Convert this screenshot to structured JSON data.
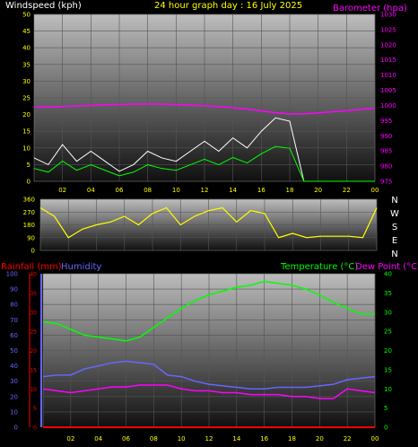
{
  "header": {
    "wind_title": "Windspeed (kph)",
    "date_title": "24 hour graph day : 16 July 2025",
    "baro_title": "Barometer (hpa)",
    "rain_title": "Rainfall (mm)",
    "hum_title": "Humidity",
    "temp_title": "Temperature (°C)",
    "dew_title": "Dew Point (°C)"
  },
  "colors": {
    "windspeed": "#ffffff",
    "windspeed_avg": "#00ff00",
    "barometer": "#ff00ff",
    "direction": "#ffff00",
    "rainfall": "#ff0000",
    "humidity": "#6666ff",
    "temperature": "#00ff00",
    "dew_point": "#ff00ff",
    "axis_left": "#ffff00",
    "axis_baro": "#ff00ff",
    "axis_hum": "#6666ff",
    "axis_rain": "#ff0000",
    "axis_temp": "#00ff00"
  },
  "x_ticks": [
    "02",
    "04",
    "06",
    "08",
    "10",
    "12",
    "14",
    "16",
    "18",
    "20",
    "22",
    "00"
  ],
  "chart_data": [
    {
      "type": "line",
      "name": "wind-baro",
      "x_hours": [
        0,
        1,
        2,
        3,
        4,
        5,
        6,
        7,
        8,
        9,
        10,
        11,
        12,
        13,
        14,
        15,
        16,
        17,
        18,
        19,
        20,
        21,
        22,
        23,
        24
      ],
      "series": [
        {
          "name": "Windspeed (kph)",
          "axis": "left",
          "values": [
            7,
            5,
            11,
            6,
            9,
            6,
            3,
            5,
            9,
            7,
            6,
            9,
            12,
            9,
            13,
            10,
            15,
            19,
            18,
            0,
            0,
            0,
            0,
            0,
            0
          ]
        },
        {
          "name": "Barometer (hpa)",
          "axis": "right",
          "values": [
            999.5,
            999.5,
            999.6,
            999.8,
            1000,
            1000.2,
            1000.3,
            1000.4,
            1000.5,
            1000.4,
            1000.3,
            1000.1,
            999.9,
            999.6,
            999.2,
            998.8,
            998.2,
            997.6,
            997.2,
            997.2,
            997.5,
            997.9,
            998.3,
            998.7,
            999.1
          ]
        }
      ],
      "ylim_left": [
        0,
        50
      ],
      "ylim_right": [
        975,
        1030
      ],
      "yticks_left": [
        0,
        5,
        10,
        15,
        20,
        25,
        30,
        35,
        40,
        45,
        50
      ],
      "yticks_right": [
        975,
        980,
        985,
        990,
        995,
        1000,
        1005,
        1010,
        1015,
        1020,
        1025,
        1030
      ]
    },
    {
      "type": "line",
      "name": "wind-direction",
      "x_hours": [
        0,
        1,
        2,
        3,
        4,
        5,
        6,
        7,
        8,
        9,
        10,
        11,
        12,
        13,
        14,
        15,
        16,
        17,
        18,
        19,
        20,
        21,
        22,
        23,
        24
      ],
      "series": [
        {
          "name": "Wind direction",
          "values": [
            300,
            240,
            90,
            150,
            180,
            200,
            240,
            180,
            260,
            300,
            180,
            240,
            280,
            300,
            200,
            280,
            260,
            90,
            120,
            90,
            100,
            100,
            100,
            90,
            300
          ]
        }
      ],
      "ylim": [
        0,
        360
      ],
      "yticks": [
        0,
        90,
        180,
        270,
        360
      ],
      "compass": [
        "N",
        "W",
        "S",
        "E",
        "N"
      ]
    },
    {
      "type": "line",
      "name": "rain-humidity-temp",
      "x_hours": [
        0,
        1,
        2,
        3,
        4,
        5,
        6,
        7,
        8,
        9,
        10,
        11,
        12,
        13,
        14,
        15,
        16,
        17,
        18,
        19,
        20,
        21,
        22,
        23,
        24
      ],
      "series": [
        {
          "name": "Temperature (°C)",
          "axis": "temp",
          "values": [
            27.5,
            27,
            25.5,
            24,
            23.5,
            23,
            22.5,
            23.5,
            26,
            28.5,
            31,
            33,
            34.5,
            35.5,
            36.5,
            37,
            38,
            37.5,
            37,
            36,
            34.5,
            32.5,
            31,
            29.5,
            29.5
          ]
        },
        {
          "name": "Humidity",
          "axis": "hum",
          "values": [
            33,
            34,
            34,
            38,
            40,
            42,
            43,
            42,
            41,
            34,
            33,
            30,
            28,
            27,
            26,
            25,
            25,
            26,
            26,
            26,
            27,
            28,
            31,
            32,
            33
          ]
        },
        {
          "name": "Dew Point (°C)",
          "axis": "temp",
          "values": [
            10,
            9.5,
            9,
            9.5,
            10,
            10.5,
            10.5,
            11,
            11,
            11,
            10,
            9.5,
            9.5,
            9,
            9,
            8.5,
            8.5,
            8.5,
            8,
            8,
            7.5,
            7.5,
            10,
            9.5,
            9
          ]
        },
        {
          "name": "Rainfall (mm)",
          "axis": "rain",
          "values": [
            0,
            0,
            0,
            0,
            0,
            0,
            0,
            0,
            0,
            0,
            0,
            0,
            0,
            0,
            0,
            0,
            0,
            0,
            0,
            0,
            0,
            0,
            0,
            0,
            0
          ]
        }
      ],
      "ylim_hum": [
        0,
        100
      ],
      "ylim_rain": [
        0,
        40
      ],
      "ylim_temp": [
        0,
        40
      ],
      "yticks_hum": [
        0,
        10,
        20,
        30,
        40,
        50,
        60,
        70,
        80,
        90,
        100
      ],
      "yticks_rain": [
        0,
        5,
        10,
        15,
        20,
        25,
        30,
        35,
        40
      ],
      "yticks_temp": [
        0,
        5,
        10,
        15,
        20,
        25,
        30,
        35,
        40
      ]
    }
  ]
}
